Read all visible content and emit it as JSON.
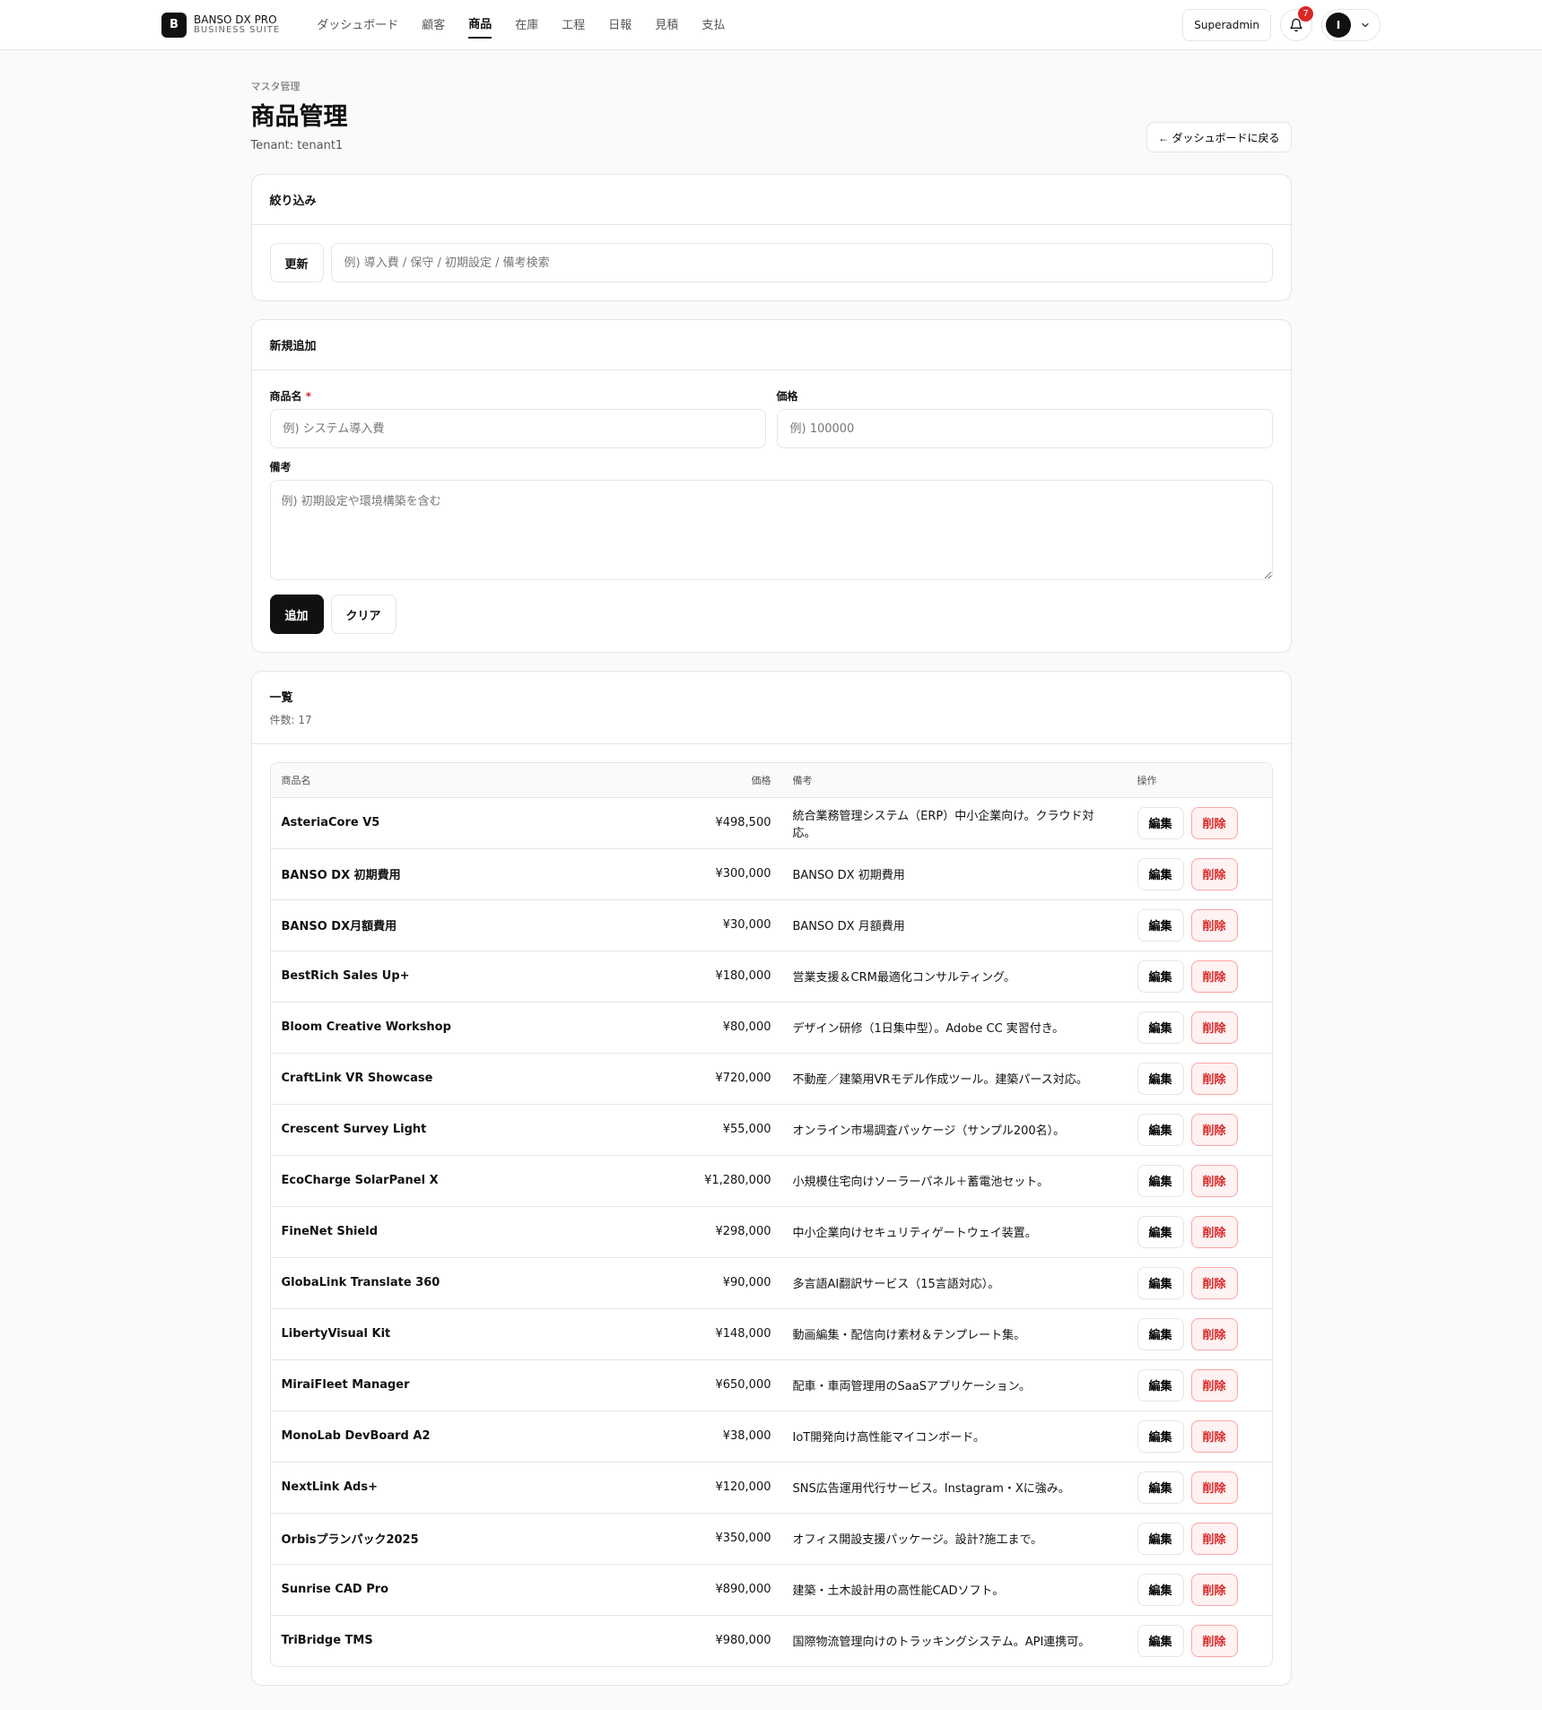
{
  "brand": {
    "mark": "B",
    "name": "BANSO DX PRO",
    "sub": "BUSINESS SUITE"
  },
  "nav": [
    {
      "label": "ダッシュボード",
      "active": false
    },
    {
      "label": "顧客",
      "active": false
    },
    {
      "label": "商品",
      "active": true
    },
    {
      "label": "在庫",
      "active": false
    },
    {
      "label": "工程",
      "active": false
    },
    {
      "label": "日報",
      "active": false
    },
    {
      "label": "見積",
      "active": false
    },
    {
      "label": "支払",
      "active": false
    }
  ],
  "header": {
    "role": "Superadmin",
    "notifications": "7",
    "avatar": "I"
  },
  "page": {
    "crumb": "マスタ管理",
    "title": "商品管理",
    "tenant": "Tenant: tenant1",
    "back": "← ダッシュボードに戻る"
  },
  "filter": {
    "title": "絞り込み",
    "refresh": "更新",
    "placeholder": "例) 導入費 / 保守 / 初期設定 / 備考検索"
  },
  "create": {
    "title": "新規追加",
    "name_label": "商品名",
    "required_mark": "*",
    "name_placeholder": "例) システム導入費",
    "price_label": "価格",
    "price_placeholder": "例) 100000",
    "note_label": "備考",
    "note_placeholder": "例) 初期設定や環境構築を含む",
    "add": "追加",
    "clear": "クリア"
  },
  "list": {
    "title": "一覧",
    "count": "件数: 17",
    "headers": {
      "name": "商品名",
      "price": "価格",
      "note": "備考",
      "ops": "操作"
    },
    "edit": "編集",
    "delete": "削除",
    "rows": [
      {
        "name": "AsteriaCore V5",
        "price": "¥498,500",
        "note": "統合業務管理システム（ERP）中小企業向け。クラウド対応。"
      },
      {
        "name": "BANSO DX 初期費用",
        "price": "¥300,000",
        "note": "BANSO DX 初期費用"
      },
      {
        "name": "BANSO DX月額費用",
        "price": "¥30,000",
        "note": "BANSO DX 月額費用"
      },
      {
        "name": "BestRich Sales Up+",
        "price": "¥180,000",
        "note": "営業支援＆CRM最適化コンサルティング。"
      },
      {
        "name": "Bloom Creative Workshop",
        "price": "¥80,000",
        "note": "デザイン研修（1日集中型）。Adobe CC 実習付き。"
      },
      {
        "name": "CraftLink VR Showcase",
        "price": "¥720,000",
        "note": "不動産／建築用VRモデル作成ツール。建築パース対応。"
      },
      {
        "name": "Crescent Survey Light",
        "price": "¥55,000",
        "note": "オンライン市場調査パッケージ（サンプル200名）。"
      },
      {
        "name": "EcoCharge SolarPanel X",
        "price": "¥1,280,000",
        "note": "小規模住宅向けソーラーパネル＋蓄電池セット。"
      },
      {
        "name": "FineNet Shield",
        "price": "¥298,000",
        "note": "中小企業向けセキュリティゲートウェイ装置。"
      },
      {
        "name": "GlobaLink Translate 360",
        "price": "¥90,000",
        "note": "多言語AI翻訳サービス（15言語対応）。"
      },
      {
        "name": "LibertyVisual Kit",
        "price": "¥148,000",
        "note": "動画編集・配信向け素材＆テンプレート集。"
      },
      {
        "name": "MiraiFleet Manager",
        "price": "¥650,000",
        "note": "配車・車両管理用のSaaSアプリケーション。"
      },
      {
        "name": "MonoLab DevBoard A2",
        "price": "¥38,000",
        "note": "IoT開発向け高性能マイコンボード。"
      },
      {
        "name": "NextLink Ads+",
        "price": "¥120,000",
        "note": "SNS広告運用代行サービス。Instagram・Xに強み。"
      },
      {
        "name": "Orbisプランパック2025",
        "price": "¥350,000",
        "note": "オフィス開設支援パッケージ。設計?施工まで。"
      },
      {
        "name": "Sunrise CAD Pro",
        "price": "¥890,000",
        "note": "建築・土木設計用の高性能CADソフト。"
      },
      {
        "name": "TriBridge TMS",
        "price": "¥980,000",
        "note": "国際物流管理向けのトラッキングシステム。API連携可。"
      }
    ]
  }
}
